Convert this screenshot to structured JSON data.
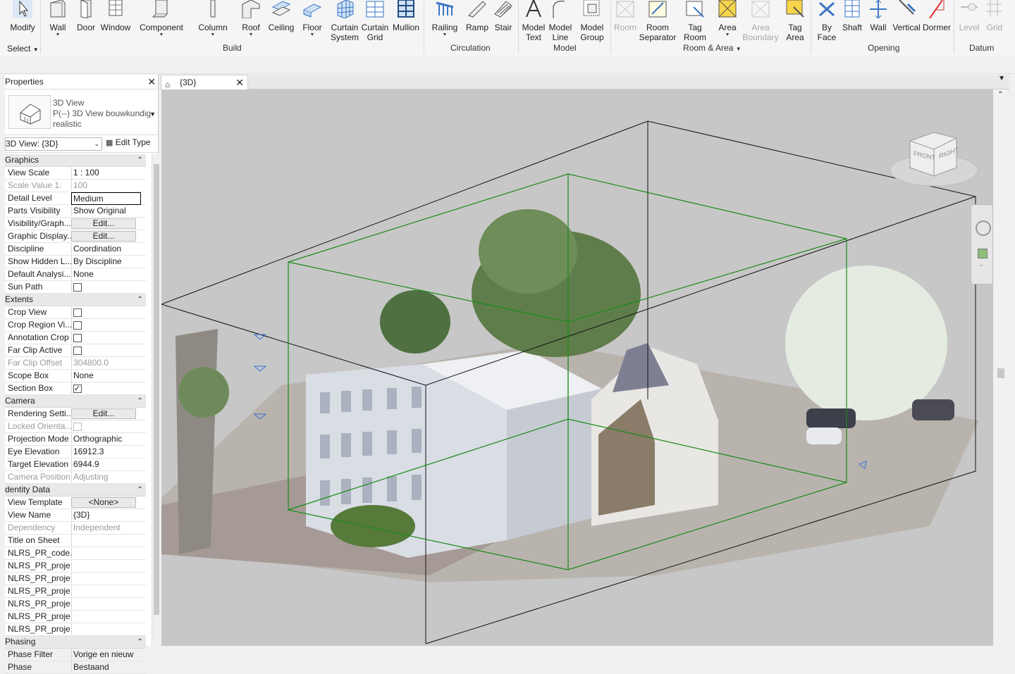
{
  "ribbon": {
    "select": "Select",
    "panels": {
      "build": "Build",
      "circulation": "Circulation",
      "model": "Model",
      "room_area": "Room & Area",
      "opening": "Opening",
      "datum": "Datum"
    },
    "tools": {
      "modify": "Modify",
      "wall": "Wall",
      "door": "Door",
      "window": "Window",
      "component": "Component",
      "column": "Column",
      "roof": "Roof",
      "ceiling": "Ceiling",
      "floor": "Floor",
      "curtain_system": "Curtain\nSystem",
      "curtain_grid": "Curtain\nGrid",
      "mullion": "Mullion",
      "railing": "Railing",
      "ramp": "Ramp",
      "stair": "Stair",
      "model_text": "Model\nText",
      "model_line": "Model\nLine",
      "model_group": "Model\nGroup",
      "room": "Room",
      "room_separator": "Room\nSeparator",
      "tag_room": "Tag\nRoom",
      "area": "Area",
      "area_boundary": "Area\nBoundary",
      "tag_area": "Tag\nArea",
      "by_face": "By\nFace",
      "shaft": "Shaft",
      "wall_opening": "Wall",
      "vertical": "Vertical",
      "dormer": "Dormer",
      "level": "Level",
      "grid": "Grid"
    }
  },
  "properties": {
    "title": "Properties",
    "type_line1": "3D View",
    "type_line2": "P(--) 3D View bouwkundig",
    "type_line3": "realistic",
    "view_selector": "3D View: {3D}",
    "edit_type": "Edit Type",
    "sections": {
      "graphics": "Graphics",
      "extents": "Extents",
      "camera": "Camera",
      "identity": "dentity Data",
      "phasing": "Phasing"
    },
    "rows": {
      "view_scale": [
        "View Scale",
        "1 : 100"
      ],
      "scale_value": [
        "Scale Value    1:",
        "100"
      ],
      "detail_level": [
        "Detail Level",
        "Medium"
      ],
      "parts_visibility": [
        "Parts Visibility",
        "Show Original"
      ],
      "visibility_graph": [
        "Visibility/Graph...",
        "Edit..."
      ],
      "graphic_display": [
        "Graphic Display...",
        "Edit..."
      ],
      "discipline": [
        "Discipline",
        "Coordination"
      ],
      "show_hidden": [
        "Show Hidden L...",
        "By Discipline"
      ],
      "default_analysis": [
        "Default Analysi...",
        "None"
      ],
      "sun_path": [
        "Sun Path",
        ""
      ],
      "crop_view": [
        "Crop View",
        ""
      ],
      "crop_region": [
        "Crop Region Vi...",
        ""
      ],
      "annotation_crop": [
        "Annotation Crop",
        ""
      ],
      "far_clip_active": [
        "Far Clip Active",
        ""
      ],
      "far_clip_offset": [
        "Far Clip Offset",
        "304800.0"
      ],
      "scope_box": [
        "Scope Box",
        "None"
      ],
      "section_box": [
        "Section Box",
        ""
      ],
      "rendering_settings": [
        "Rendering Setti...",
        "Edit..."
      ],
      "locked_orientation": [
        "Locked Orienta...",
        ""
      ],
      "projection_mode": [
        "Projection Mode",
        "Orthographic"
      ],
      "eye_elevation": [
        "Eye Elevation",
        "16912.3"
      ],
      "target_elevation": [
        "Target Elevation",
        "6944.9"
      ],
      "camera_position": [
        "Camera Position",
        "Adjusting"
      ],
      "view_template": [
        "View Template",
        "<None>"
      ],
      "view_name": [
        "View Name",
        "{3D}"
      ],
      "dependency": [
        "Dependency",
        "Independent"
      ],
      "title_on_sheet": [
        "Title on Sheet",
        ""
      ],
      "nlrs1": [
        "NLRS_PR_code...",
        ""
      ],
      "nlrs2": [
        "NLRS_PR_proje...",
        ""
      ],
      "nlrs3": [
        "NLRS_PR_proje...",
        ""
      ],
      "nlrs4": [
        "NLRS_PR_proje...",
        ""
      ],
      "nlrs5": [
        "NLRS_PR_proje...",
        ""
      ],
      "nlrs6": [
        "NLRS_PR_proje...",
        ""
      ],
      "nlrs7": [
        "NLRS_PR_proje...",
        ""
      ],
      "phase_filter": [
        "Phase Filter",
        "Vorige en nieuw"
      ],
      "phase": [
        "Phase",
        "Bestaand"
      ]
    },
    "checkbox_states": {
      "sun_path": false,
      "crop_view": false,
      "crop_region": false,
      "annotation_crop": false,
      "far_clip_active": false,
      "section_box": true,
      "locked_orientation": false
    }
  },
  "view": {
    "tab_label": "{3D}",
    "viewcube_front": "FRONT",
    "viewcube_right": "RIGHT"
  },
  "colors": {
    "viewport_bg": "#c7c7c7",
    "section_box": "#1a8a1a",
    "accent": "#1f6fd1"
  }
}
